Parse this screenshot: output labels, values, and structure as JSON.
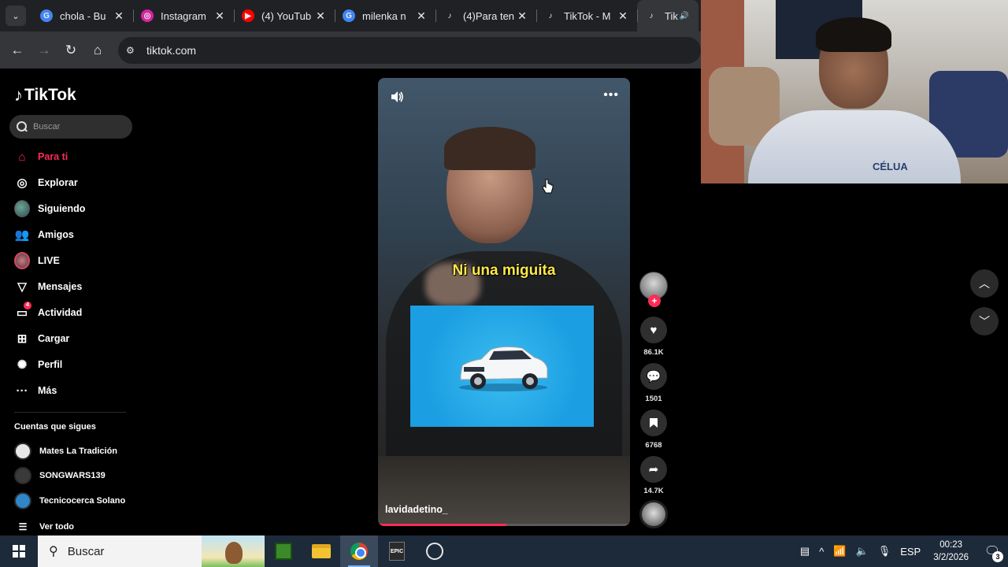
{
  "browser": {
    "tabs": [
      {
        "title": "chola - Bu",
        "icon": "google-icon",
        "color": "#4285f4",
        "active": false
      },
      {
        "title": "Instagram",
        "icon": "instagram-icon",
        "color": "#d6249f",
        "active": false
      },
      {
        "title": "(4) YouTub",
        "icon": "youtube-icon",
        "color": "#ff0000",
        "active": false
      },
      {
        "title": "milenka n",
        "icon": "google-icon",
        "color": "#4285f4",
        "active": false
      },
      {
        "title": "(4)Para ten",
        "icon": "tiktok-icon",
        "color": "#000000",
        "active": false
      },
      {
        "title": "TikTok - M",
        "icon": "tiktok-icon",
        "color": "#000000",
        "active": false
      },
      {
        "title": "TikTok",
        "icon": "tiktok-icon",
        "color": "#000000",
        "active": true
      }
    ],
    "url": "tiktok.com"
  },
  "tiktok": {
    "logo": "TikTok",
    "search_placeholder": "Buscar",
    "nav": [
      {
        "label": "Para ti",
        "icon": "home-icon",
        "active": true
      },
      {
        "label": "Explorar",
        "icon": "compass-icon",
        "active": false
      },
      {
        "label": "Siguiendo",
        "icon": "following-avatar-icon",
        "active": false
      },
      {
        "label": "Amigos",
        "icon": "friends-icon",
        "active": false
      },
      {
        "label": "LIVE",
        "icon": "live-icon",
        "active": false
      },
      {
        "label": "Mensajes",
        "icon": "messages-icon",
        "active": false
      },
      {
        "label": "Actividad",
        "icon": "activity-icon",
        "active": false,
        "badge": "4"
      },
      {
        "label": "Cargar",
        "icon": "upload-icon",
        "active": false
      },
      {
        "label": "Perfil",
        "icon": "profile-icon",
        "active": false
      },
      {
        "label": "Más",
        "icon": "more-icon",
        "active": false
      }
    ],
    "following_title": "Cuentas que sigues",
    "following": [
      {
        "name": "Mates La Tradición",
        "color": "#e8e8e8"
      },
      {
        "name": "SONGWARS139",
        "color": "#3a3a3a"
      },
      {
        "name": "Tecnicocerca Solano",
        "color": "#2f86c9"
      }
    ],
    "see_all": "Ver todo",
    "accent": "#fe2c55"
  },
  "video": {
    "caption": "Ni una miguita",
    "author": "lavidadetino_",
    "progress": 0.51,
    "likes": "86.1K",
    "comments": "1501",
    "saves": "6768",
    "shares": "14.7K"
  },
  "webcam": {
    "shirt_text": "CÉLUA"
  },
  "taskbar": {
    "search_placeholder": "Buscar",
    "epic_label": "EPIC",
    "language": "ESP",
    "time": "00:23",
    "date": "3/2/2026",
    "notifications": "3"
  }
}
